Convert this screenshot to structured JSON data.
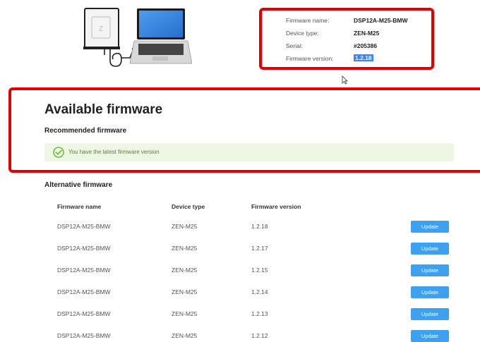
{
  "device_info": {
    "firmware_name_label": "Firmware name:",
    "firmware_name_value": "DSP12A-M25-BMW",
    "device_type_label": "Device type:",
    "device_type_value": "ZEN-M25",
    "serial_label": "Serial:",
    "serial_value": "#205386",
    "firmware_version_label": "Firmware version:",
    "firmware_version_value": "1.2.18"
  },
  "recommended": {
    "title": "Available firmware",
    "heading": "Recommended firmware",
    "latest_message": "You have the latest firmware version"
  },
  "alternative": {
    "heading": "Alternative firmware",
    "columns": [
      "Firmware name",
      "Device type",
      "Firmware version"
    ],
    "update_label": "Update",
    "rows": [
      {
        "name": "DSP12A-M25-BMW",
        "device": "ZEN-M25",
        "version": "1.2.18"
      },
      {
        "name": "DSP12A-M25-BMW",
        "device": "ZEN-M25",
        "version": "1.2.17"
      },
      {
        "name": "DSP12A-M25-BMW",
        "device": "ZEN-M25",
        "version": "1.2.15"
      },
      {
        "name": "DSP12A-M25-BMW",
        "device": "ZEN-M25",
        "version": "1.2.14"
      },
      {
        "name": "DSP12A-M25-BMW",
        "device": "ZEN-M25",
        "version": "1.2.13"
      },
      {
        "name": "DSP12A-M25-BMW",
        "device": "ZEN-M25",
        "version": "1.2.12"
      }
    ]
  },
  "colors": {
    "highlight_border": "#e50000",
    "update_button": "#3ea1f0",
    "success_banner": "#eef7e3",
    "success_check": "#6cbf3c"
  },
  "icons": {
    "device": "dsp-device-icon",
    "laptop": "laptop-icon",
    "cable": "usb-cable-icon",
    "check": "check-circle-icon",
    "cursor": "mouse-cursor-icon"
  }
}
